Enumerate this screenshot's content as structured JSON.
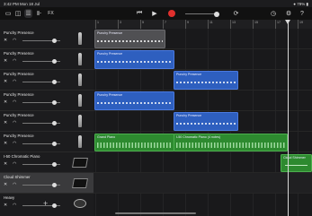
{
  "status_bar": {
    "time": "3:42 PM  Mon 18 Jul",
    "right": "● 79% ▮"
  },
  "toolbar": {
    "icons": [
      "tracks-view-icon",
      "browser-icon",
      "mixer-icon",
      "fx-icon",
      "go-to-start-icon",
      "play-icon",
      "record-icon",
      "metronome-icon",
      "loop-icon",
      "settings-icon",
      "help-icon"
    ],
    "fx_label": "FX"
  },
  "tracks": [
    {
      "name": "Punchy Presence",
      "instrument": "mic-icon"
    },
    {
      "name": "Punchy Presence",
      "instrument": "mic-icon"
    },
    {
      "name": "Punchy Presence",
      "instrument": "mic-icon"
    },
    {
      "name": "Punchy Presence",
      "instrument": "mic-icon"
    },
    {
      "name": "Punchy Presence",
      "instrument": "mic-icon"
    },
    {
      "name": "Punchy Presence",
      "instrument": "mic-icon"
    },
    {
      "name": "I-50 Chromatic Piano",
      "instrument": "keyboard-icon"
    },
    {
      "name": "Cloud Shimmer",
      "instrument": "keyboard-icon"
    },
    {
      "name": "Heavy",
      "instrument": "drums-icon"
    }
  ],
  "ruler": [
    "1",
    "3",
    "5",
    "7",
    "9",
    "11",
    "13",
    "15",
    "17",
    "19"
  ],
  "regions": [
    {
      "label": "Punchy Presence",
      "kind": "audio-gray"
    },
    {
      "label": "Punchy Presence",
      "kind": "audio"
    },
    {
      "label": "Punchy Presence",
      "kind": "audio"
    },
    {
      "label": "Punchy Presence",
      "kind": "audio"
    },
    {
      "label": "Punchy Presence",
      "kind": "audio"
    },
    {
      "label": "Grand Piano",
      "kind": "midi"
    },
    {
      "label": "I-50 Chromatic Piano (4 notes)",
      "kind": "midi"
    },
    {
      "label": "Cloud Shimmer",
      "kind": "midi"
    }
  ],
  "add_track_label": "+"
}
